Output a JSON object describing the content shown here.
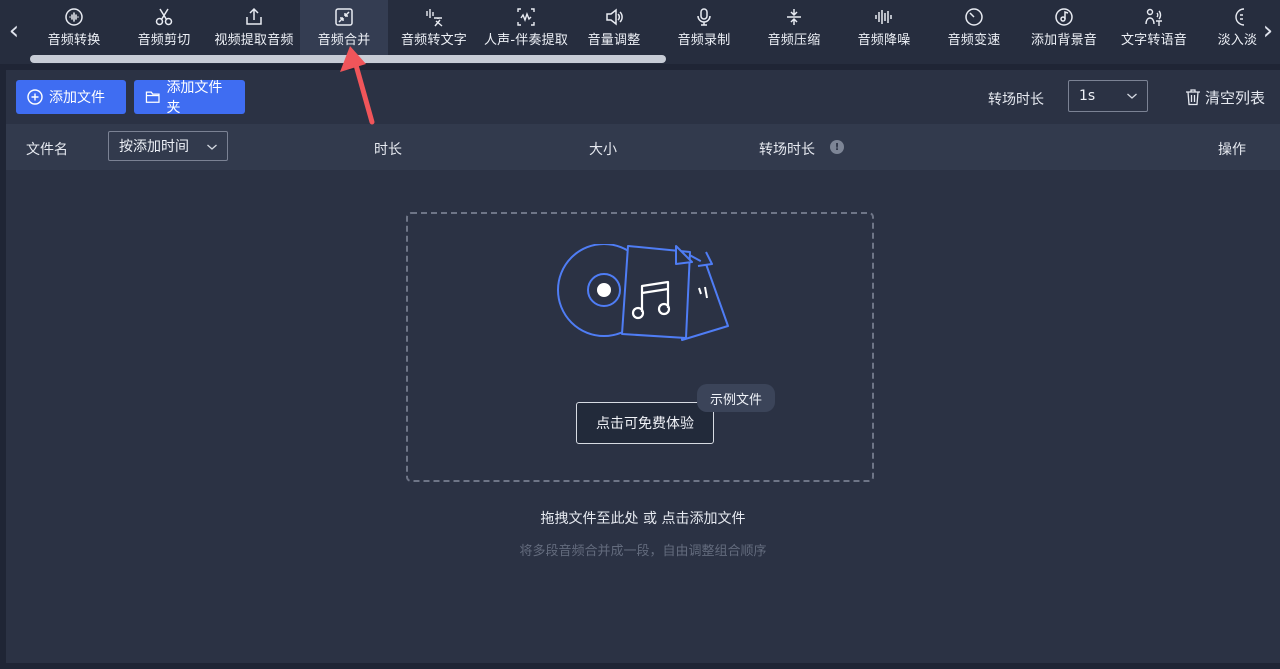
{
  "toolbar": {
    "prev_glyph": "‹",
    "next_glyph": "›",
    "items": [
      {
        "label": "音频转换",
        "icon": "audio-wave-icon"
      },
      {
        "label": "音频剪切",
        "icon": "scissors-icon"
      },
      {
        "label": "视频提取音频",
        "icon": "upload-icon"
      },
      {
        "label": "音频合并",
        "icon": "merge-arrows-icon",
        "active": true
      },
      {
        "label": "音频转文字",
        "icon": "audio-to-text-icon"
      },
      {
        "label": "人声-伴奏提取",
        "icon": "vocal-extract-icon"
      },
      {
        "label": "音量调整",
        "icon": "volume-icon"
      },
      {
        "label": "音频录制",
        "icon": "microphone-icon"
      },
      {
        "label": "音频压缩",
        "icon": "compress-icon"
      },
      {
        "label": "音频降噪",
        "icon": "denoise-icon"
      },
      {
        "label": "音频变速",
        "icon": "speed-dial-icon"
      },
      {
        "label": "添加背景音",
        "icon": "music-disc-icon"
      },
      {
        "label": "文字转语音",
        "icon": "text-to-speech-icon"
      },
      {
        "label": "淡入淡出",
        "icon": "fade-icon"
      }
    ]
  },
  "actions": {
    "add_file": "添加文件",
    "add_folder": "添加文件夹",
    "transition_label": "转场时长",
    "transition_value": "1s",
    "clear_list": "清空列表"
  },
  "table": {
    "col_filename": "文件名",
    "sort_value": "按添加时间",
    "col_duration": "时长",
    "col_size": "大小",
    "col_transition": "转场时长",
    "info_glyph": "!",
    "col_actions": "操作"
  },
  "dropzone": {
    "try_button": "点击可免费体验",
    "sample_tag": "示例文件",
    "hint_main": "拖拽文件至此处 或 点击添加文件",
    "hint_sub": "将多段音频合并成一段，自由调整组合顺序"
  },
  "colors": {
    "accent": "#3f6df2",
    "annotation": "#f0555a",
    "illustration": "#4f7df5"
  }
}
